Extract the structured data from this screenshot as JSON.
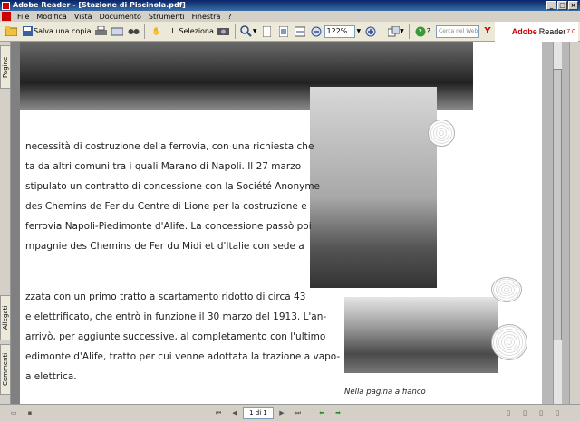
{
  "window": {
    "title": "Adobe Reader - [Stazione di Piscinola.pdf]"
  },
  "menu": [
    "File",
    "Modifica",
    "Vista",
    "Documento",
    "Strumenti",
    "Finestra",
    "?"
  ],
  "toolbar": {
    "save_copy_label": "Salva una copia",
    "select_label": "Seleziona",
    "zoom_value": "122%",
    "help_label": "?",
    "search_placeholder": "Cerca nel Web"
  },
  "brand": {
    "name": "Adobe",
    "product": "Reader",
    "version": "7.0"
  },
  "sidebar": {
    "tabs": [
      "Pagine",
      "Allegati",
      "Commenti"
    ]
  },
  "document": {
    "lines": [
      "necessità di costruzione della ferrovia, con una richiesta che",
      "ta da altri comuni tra i quali Marano di Napoli. Il 27 marzo",
      "stipulato un contratto di concessione con la Société Anonyme",
      " des Chemins de Fer du Centre di Lione per la costruzione e",
      " ferrovia Napoli-Piedimonte d'Alife. La concessione passò poi",
      "mpagnie des Chemins de Fer du Midi et d'Italie con sede a",
      "zzata con un primo tratto a scartamento ridotto di circa 43",
      "e elettrificato, che entrò in funzione il 30 marzo del 1913. L'an-",
      "arrivò, per aggiunte successive, al completamento con l'ultimo",
      "edimonte d'Alife, tratto per cui venne adottata la trazione a vapo-",
      "a elettrica."
    ],
    "caption": "Nella pagina a fianco"
  },
  "statusbar": {
    "page_value": "1 di 1"
  }
}
